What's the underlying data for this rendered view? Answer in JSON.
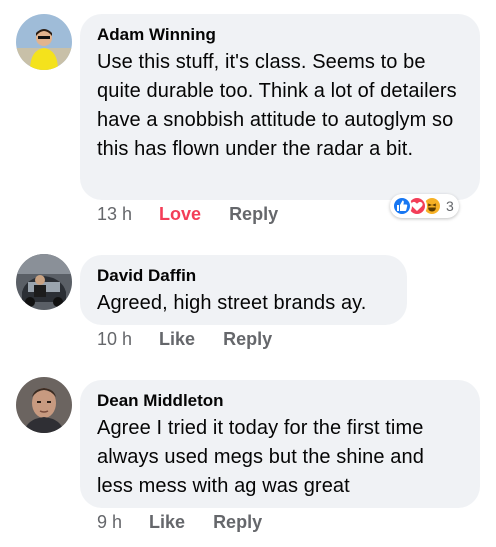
{
  "comments": [
    {
      "author": "Adam Winning",
      "text": "Use this stuff, it's class. Seems to be quite durable too. Think a lot of detailers have a snobbish attitude to autoglym so this has flown under the radar a bit.",
      "time": "13 h",
      "reaction_label": "Love",
      "reply_label": "Reply",
      "reaction_count": "3",
      "reaction_icons": [
        "like-icon",
        "love-icon",
        "haha-icon"
      ]
    },
    {
      "author": "David Daffin",
      "text": "Agreed, high street brands ay.",
      "time": "10 h",
      "reaction_label": "Like",
      "reply_label": "Reply"
    },
    {
      "author": "Dean Middleton",
      "text": "Agree I tried it today for the first time always used megs but the shine and less mess with ag was great",
      "time": "9 h",
      "reaction_label": "Like",
      "reply_label": "Reply"
    }
  ],
  "colors": {
    "bubble_bg": "#f0f2f5",
    "meta_text": "#65676b",
    "love_red": "#f33e58",
    "like_blue": "#1877f2",
    "haha_yellow": "#f7b125"
  }
}
